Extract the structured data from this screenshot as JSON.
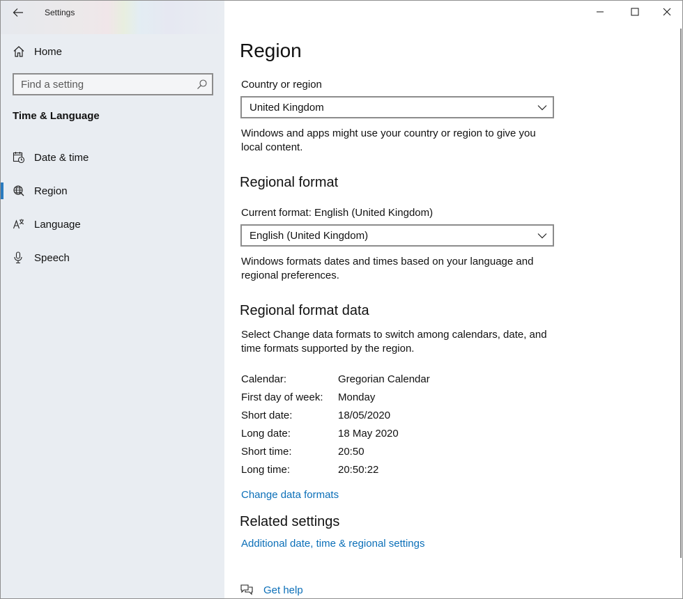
{
  "app": {
    "title": "Settings"
  },
  "sidebar": {
    "home_label": "Home",
    "search_placeholder": "Find a setting",
    "section_heading": "Time & Language",
    "items": [
      {
        "label": "Date & time",
        "icon": "calendar-clock-icon"
      },
      {
        "label": "Region",
        "icon": "globe-icon",
        "selected": true
      },
      {
        "label": "Language",
        "icon": "language-icon"
      },
      {
        "label": "Speech",
        "icon": "microphone-icon"
      }
    ]
  },
  "main": {
    "title": "Region",
    "country": {
      "label": "Country or region",
      "selected": "United Kingdom",
      "description_line1": "Windows and apps might use your country or region to give you",
      "description_line2": "local content."
    },
    "regional_format": {
      "heading": "Regional format",
      "current_label": "Current format: English (United Kingdom)",
      "selected": "English (United Kingdom)",
      "description_line1": "Windows formats dates and times based on your language and",
      "description_line2": "regional preferences."
    },
    "format_data": {
      "heading": "Regional format data",
      "description_line1": "Select Change data formats to switch among calendars, date, and",
      "description_line2": "time formats supported by the region.",
      "rows": [
        {
          "key": "Calendar:",
          "value": "Gregorian Calendar"
        },
        {
          "key": "First day of week:",
          "value": "Monday"
        },
        {
          "key": "Short date:",
          "value": "18/05/2020"
        },
        {
          "key": "Long date:",
          "value": "18 May 2020"
        },
        {
          "key": "Short time:",
          "value": "20:50"
        },
        {
          "key": "Long time:",
          "value": "20:50:22"
        }
      ],
      "change_link": "Change data formats"
    },
    "related": {
      "heading": "Related settings",
      "link": "Additional date, time & regional settings"
    },
    "help_label": "Get help"
  },
  "colors": {
    "accent": "#0b6fb8",
    "selection_bar": "#2a7bbf",
    "sidebar_bg": "#e9edf2"
  }
}
